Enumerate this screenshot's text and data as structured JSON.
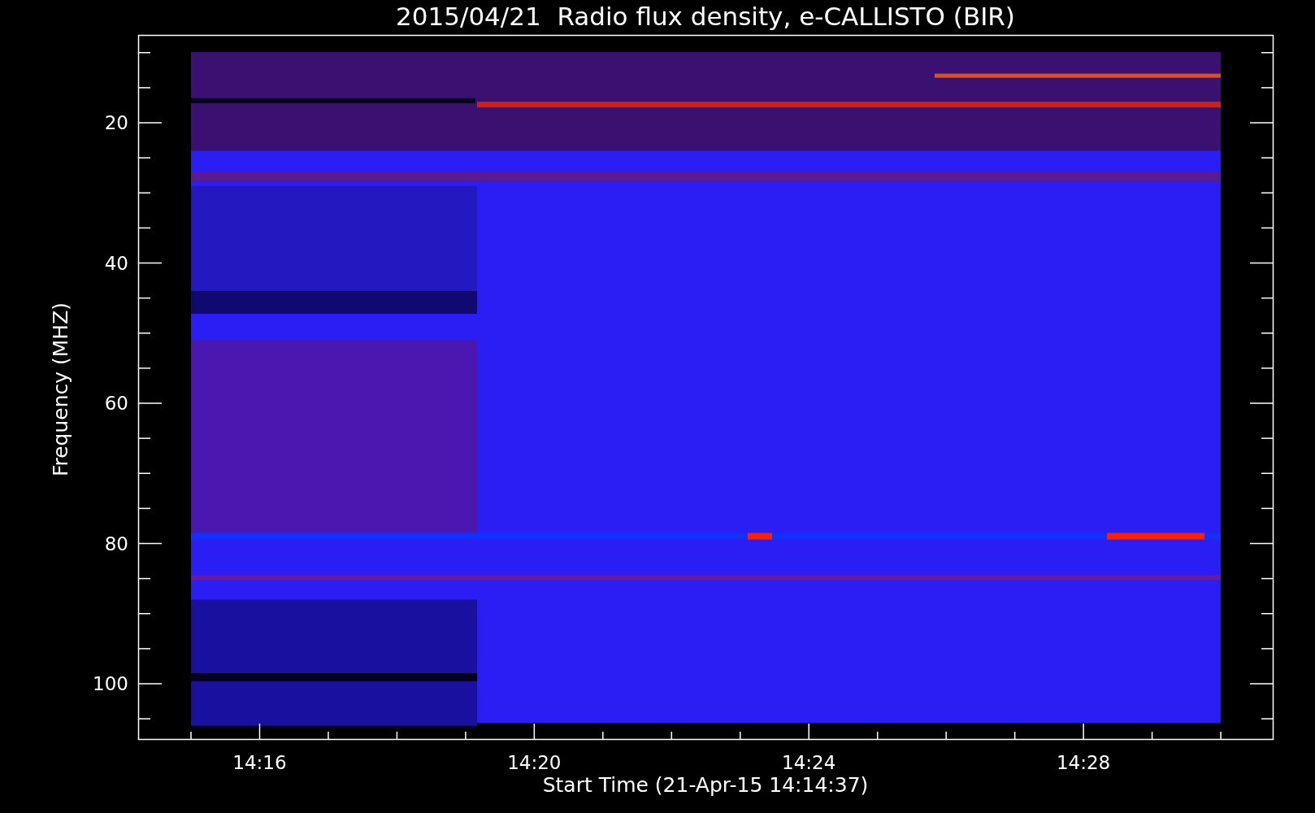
{
  "title": "2015/04/21  Radio flux density, e-CALLISTO (BIR)",
  "ylabel": "Frequency (MHZ)",
  "xlabel": "Start Time (21-Apr-15 14:14:37)",
  "yticks": [
    "20",
    "40",
    "60",
    "80",
    "100"
  ],
  "xticks": [
    "14:16",
    "14:20",
    "14:24",
    "14:28"
  ]
}
